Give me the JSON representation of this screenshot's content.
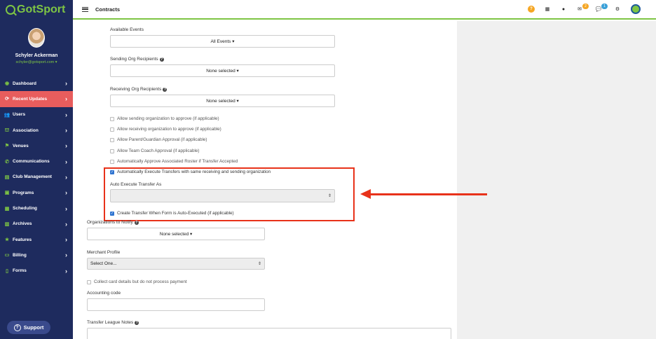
{
  "app": {
    "logo": "GotSport",
    "brand_color": "#7ec544",
    "sidebar_color": "#1e2b5e",
    "active_color": "#e85d5d"
  },
  "user": {
    "name": "Schyler Ackerman",
    "email": "schyler@gotsport.com"
  },
  "nav": [
    {
      "label": "Dashboard",
      "icon": "dashboard-icon"
    },
    {
      "label": "Recent Updates",
      "icon": "updates-icon",
      "active": true
    },
    {
      "label": "Users",
      "icon": "users-icon"
    },
    {
      "label": "Association",
      "icon": "association-icon"
    },
    {
      "label": "Venues",
      "icon": "venues-icon"
    },
    {
      "label": "Communications",
      "icon": "communications-icon"
    },
    {
      "label": "Club Management",
      "icon": "club-icon"
    },
    {
      "label": "Programs",
      "icon": "programs-icon"
    },
    {
      "label": "Scheduling",
      "icon": "scheduling-icon"
    },
    {
      "label": "Archives",
      "icon": "archives-icon"
    },
    {
      "label": "Features",
      "icon": "features-icon"
    },
    {
      "label": "Billing",
      "icon": "billing-icon"
    },
    {
      "label": "Forms",
      "icon": "forms-icon"
    }
  ],
  "support_label": "Support",
  "topbar": {
    "title": "Contracts",
    "mail_count": "2",
    "chat_count": "1"
  },
  "form": {
    "available_events_label": "Available Events",
    "available_events_value": "All Events ▾",
    "sending_org_label": "Sending Org Recipients",
    "sending_org_value": "None selected ▾",
    "receiving_org_label": "Receiving Org Recipients",
    "receiving_org_value": "None selected ▾",
    "checks": [
      "Allow sending organization to approve (if applicable)",
      "Allow receiving organization to approve (if applicable)",
      "Allow Parent/Guardian Approval (if applicable)",
      "Allow Team Coach Approval (if applicable)",
      "Automatically Approve Associated Roster if Transfer Accepted"
    ],
    "auto_execute_check": "Automatically Execute Transfers with same receiving and sending organization",
    "auto_execute_as_label": "Auto Execute Transfer As",
    "auto_execute_as_value": "",
    "create_transfer_check": "Create Transfer When Form is Auto-Executed (if applicable)",
    "orgs_notify_label": "Organizations to Notify",
    "orgs_notify_value": "None selected ▾",
    "merchant_label": "Merchant Profile",
    "merchant_value": "Select One...",
    "collect_card_check": "Collect card details but do not process payment",
    "accounting_label": "Accounting code",
    "league_notes_label": "Transfer League Notes"
  }
}
